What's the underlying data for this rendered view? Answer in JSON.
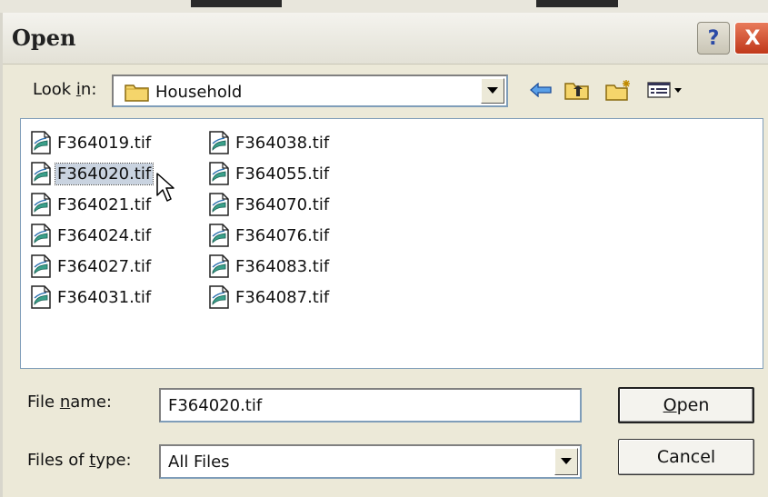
{
  "dialog": {
    "title": "Open",
    "help_glyph": "?",
    "close_glyph": "X"
  },
  "lookin": {
    "label_pre": "Look ",
    "label_accel": "i",
    "label_post": "n:",
    "value": "Household",
    "folder_icon": "folder-icon"
  },
  "toolbar": {
    "icons": [
      "back-arrow-icon",
      "up-folder-icon",
      "new-folder-icon",
      "view-menu-icon"
    ]
  },
  "files": [
    {
      "name": "F364019.tif",
      "selected": false
    },
    {
      "name": "F364020.tif",
      "selected": true
    },
    {
      "name": "F364021.tif",
      "selected": false
    },
    {
      "name": "F364024.tif",
      "selected": false
    },
    {
      "name": "F364027.tif",
      "selected": false
    },
    {
      "name": "F364031.tif",
      "selected": false
    },
    {
      "name": "F364038.tif",
      "selected": false
    },
    {
      "name": "F364055.tif",
      "selected": false
    },
    {
      "name": "F364070.tif",
      "selected": false
    },
    {
      "name": "F364076.tif",
      "selected": false
    },
    {
      "name": "F364083.tif",
      "selected": false
    },
    {
      "name": "F364087.tif",
      "selected": false
    }
  ],
  "filename": {
    "label_pre": "File ",
    "label_accel": "n",
    "label_post": "ame:",
    "value": "F364020.tif"
  },
  "filetype": {
    "label_pre": "Files of ",
    "label_accel": "t",
    "label_post": "ype:",
    "value": "All Files"
  },
  "buttons": {
    "open_accel": "O",
    "open_rest": "pen",
    "cancel": "Cancel"
  },
  "colors": {
    "selection": "#c9d3e0",
    "close_button": "#c0381a",
    "dialog_bg": "#ece9d8"
  }
}
